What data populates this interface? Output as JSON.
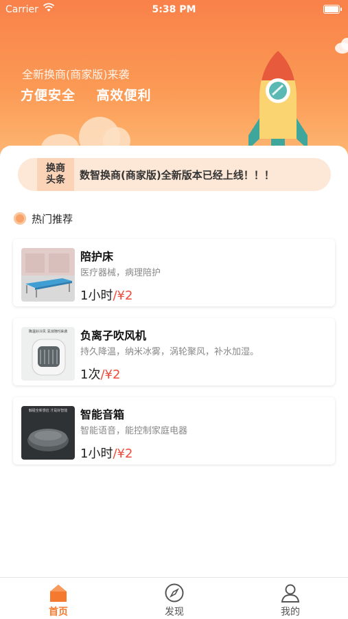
{
  "status_bar": {
    "carrier": "Carrier",
    "time": "5:38 PM"
  },
  "banner": {
    "subtitle": "全新换商(商家版)来袭",
    "title": "方便安全    高效便利"
  },
  "news": {
    "tag_line1": "换商",
    "tag_line2": "头条",
    "text": "数智换商(商家版)全新版本已经上线！！！"
  },
  "hot": {
    "title": "热门推荐",
    "items": [
      {
        "name": "陪护床",
        "desc": "医疗器械，病理陪护",
        "unit": "1小时",
        "price": "/¥2",
        "icon": "bed-image"
      },
      {
        "name": "负离子吹风机",
        "desc": "持久降温，纳米冰雾，涡轮聚风，补水加湿。",
        "unit": "1次",
        "price": "/¥2",
        "icon": "fan-image",
        "thumb_text": "降温好冷风 清凉随时来袭"
      },
      {
        "name": "智能音箱",
        "desc": "智能语音，能控制家庭电器",
        "unit": "1小时",
        "price": "/¥2",
        "icon": "speaker-image",
        "thumb_text": "触碰全新感应 才是好智能"
      }
    ]
  },
  "tabs": [
    {
      "label": "首页",
      "icon": "home-icon",
      "active": true
    },
    {
      "label": "发现",
      "icon": "compass-icon",
      "active": false
    },
    {
      "label": "我的",
      "icon": "user-icon",
      "active": false
    }
  ],
  "colors": {
    "accent": "#f57a2f",
    "price": "#f04a3a",
    "banner_top": "#f9814a"
  }
}
